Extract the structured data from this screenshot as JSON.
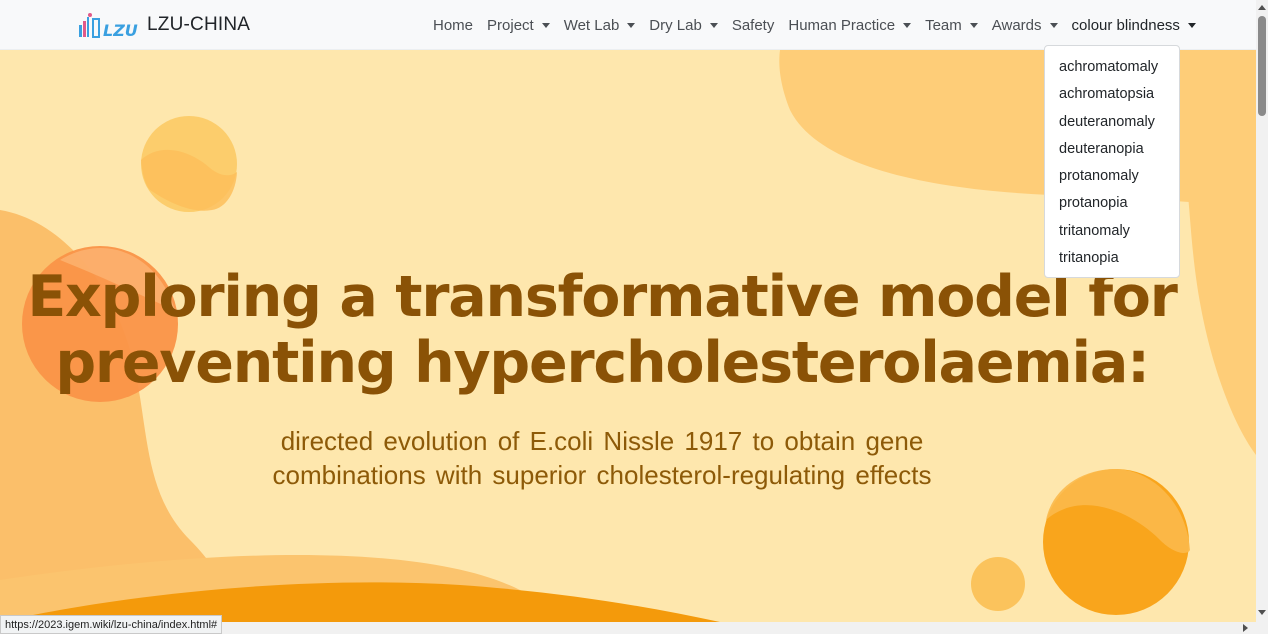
{
  "brand": {
    "name": "LZU-CHINA",
    "logo_text": "LZU"
  },
  "nav": {
    "items": [
      {
        "label": "Home",
        "has_caret": false
      },
      {
        "label": "Project",
        "has_caret": true
      },
      {
        "label": "Wet Lab",
        "has_caret": true
      },
      {
        "label": "Dry Lab",
        "has_caret": true
      },
      {
        "label": "Safety",
        "has_caret": false
      },
      {
        "label": "Human Practice",
        "has_caret": true
      },
      {
        "label": "Team",
        "has_caret": true
      },
      {
        "label": "Awards",
        "has_caret": true
      },
      {
        "label": "colour blindness",
        "has_caret": true
      }
    ]
  },
  "dropdown": {
    "items": [
      "achromatomaly",
      "achromatopsia",
      "deuteranomaly",
      "deuteranopia",
      "protanomaly",
      "protanopia",
      "tritanomaly",
      "tritanopia"
    ]
  },
  "hero": {
    "headline_line1": "Exploring a transformative model for",
    "headline_line2": "preventing hypercholesterolaemia:",
    "subtitle_line1": "directed evolution of E.coli Nissle 1917 to obtain gene",
    "subtitle_line2": "combinations with superior cholesterol-regulating effects"
  },
  "status": {
    "url": "https://2023.igem.wiki/lzu-china/index.html#"
  },
  "colors": {
    "hero_bg": "#fee7ad",
    "blob": "#fecd78",
    "headline": "#8a5206",
    "subtitle": "#8d5a08",
    "accent_orange": "#f49a0b"
  }
}
